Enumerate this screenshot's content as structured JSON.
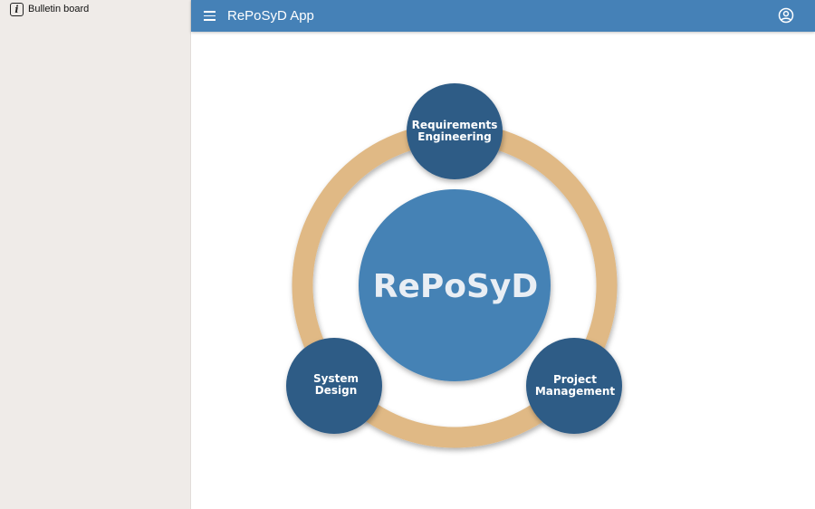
{
  "sidebar": {
    "items": [
      {
        "label": "Bulletin board",
        "icon": "info-icon"
      }
    ]
  },
  "appbar": {
    "title": "RePoSyD App",
    "menu_icon": "menu-icon",
    "account_icon": "account-circle-icon"
  },
  "diagram": {
    "center_label": "RePoSyD",
    "nodes": [
      {
        "line1": "Requirements",
        "line2": "Engineering"
      },
      {
        "line1": "System",
        "line2": "Design"
      },
      {
        "line1": "Project",
        "line2": "Management"
      }
    ]
  },
  "colors": {
    "appbar": "#4581b7",
    "sidebar": "#efebe8",
    "ring": "#e0b985",
    "center_circle": "#4582b5",
    "node_circle": "#2f5b86"
  }
}
